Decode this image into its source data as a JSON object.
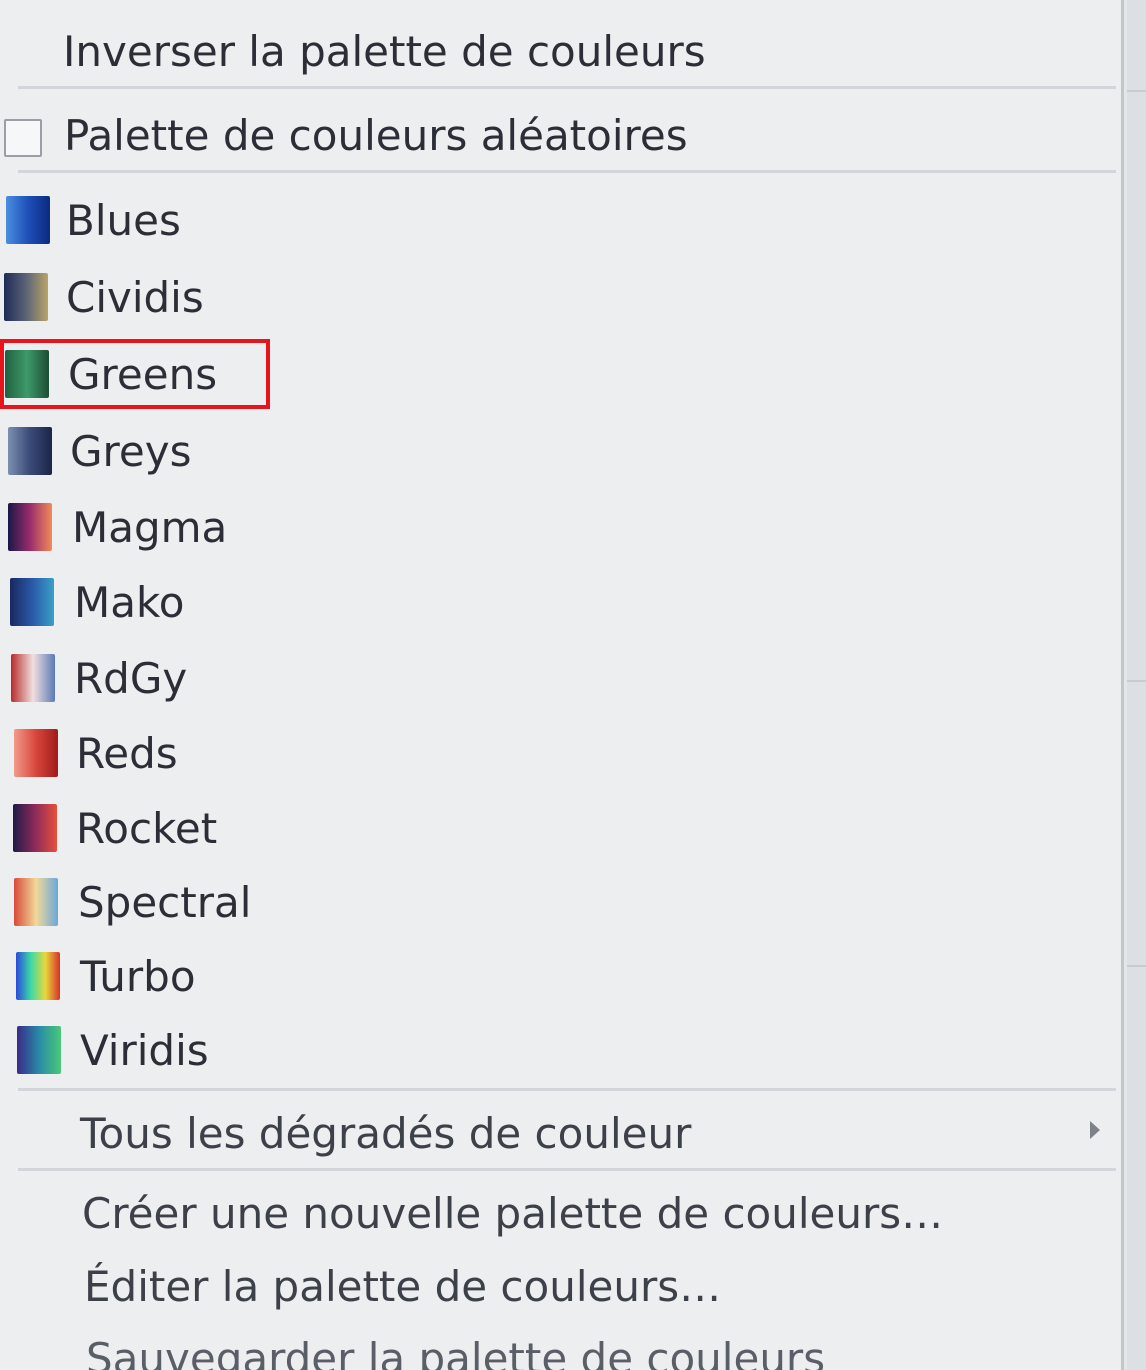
{
  "menu": {
    "invert_label": "Inverser la palette de couleurs",
    "random_label": "Palette de couleurs aléatoires",
    "random_checked": false,
    "palettes": [
      {
        "label": "Blues",
        "gradient": [
          "#4a8fe0",
          "#1f4fb8",
          "#0b2a80"
        ]
      },
      {
        "label": "Cividis",
        "gradient": [
          "#1d2b57",
          "#5c6277",
          "#b8a468"
        ]
      },
      {
        "label": "Greens",
        "gradient": [
          "#20603f",
          "#3e9a6a",
          "#1d4d36"
        ]
      },
      {
        "label": "Greys",
        "gradient": [
          "#7d8fb0",
          "#3a4a78",
          "#1c2448"
        ]
      },
      {
        "label": "Magma",
        "gradient": [
          "#1a1848",
          "#9a2c6c",
          "#f28a5a"
        ]
      },
      {
        "label": "Mako",
        "gradient": [
          "#1a2860",
          "#2a58a8",
          "#3aa0c8"
        ]
      },
      {
        "label": "RdGy",
        "gradient": [
          "#b82c2c",
          "#f2dede",
          "#5a7ab8"
        ]
      },
      {
        "label": "Reds",
        "gradient": [
          "#f29a8a",
          "#d8463c",
          "#a01a1a"
        ]
      },
      {
        "label": "Rocket",
        "gradient": [
          "#1e1a48",
          "#8c2a5a",
          "#e8503c"
        ]
      },
      {
        "label": "Spectral",
        "gradient": [
          "#d84a3a",
          "#f2d89a",
          "#6aa8d8"
        ]
      },
      {
        "label": "Turbo",
        "gradient": [
          "#2a4ad8",
          "#3ad8a8",
          "#e8d83a",
          "#d8302a"
        ]
      },
      {
        "label": "Viridis",
        "gradient": [
          "#3a2a8a",
          "#2a8aa8",
          "#4ac878"
        ]
      }
    ],
    "highlighted": "Greens",
    "all_gradients_label": "Tous les dégradés de couleur",
    "create_label": "Créer une nouvelle palette de couleurs…",
    "edit_label": "Éditer la palette de couleurs…",
    "save_label": "Sauvegarder la palette de couleurs"
  }
}
